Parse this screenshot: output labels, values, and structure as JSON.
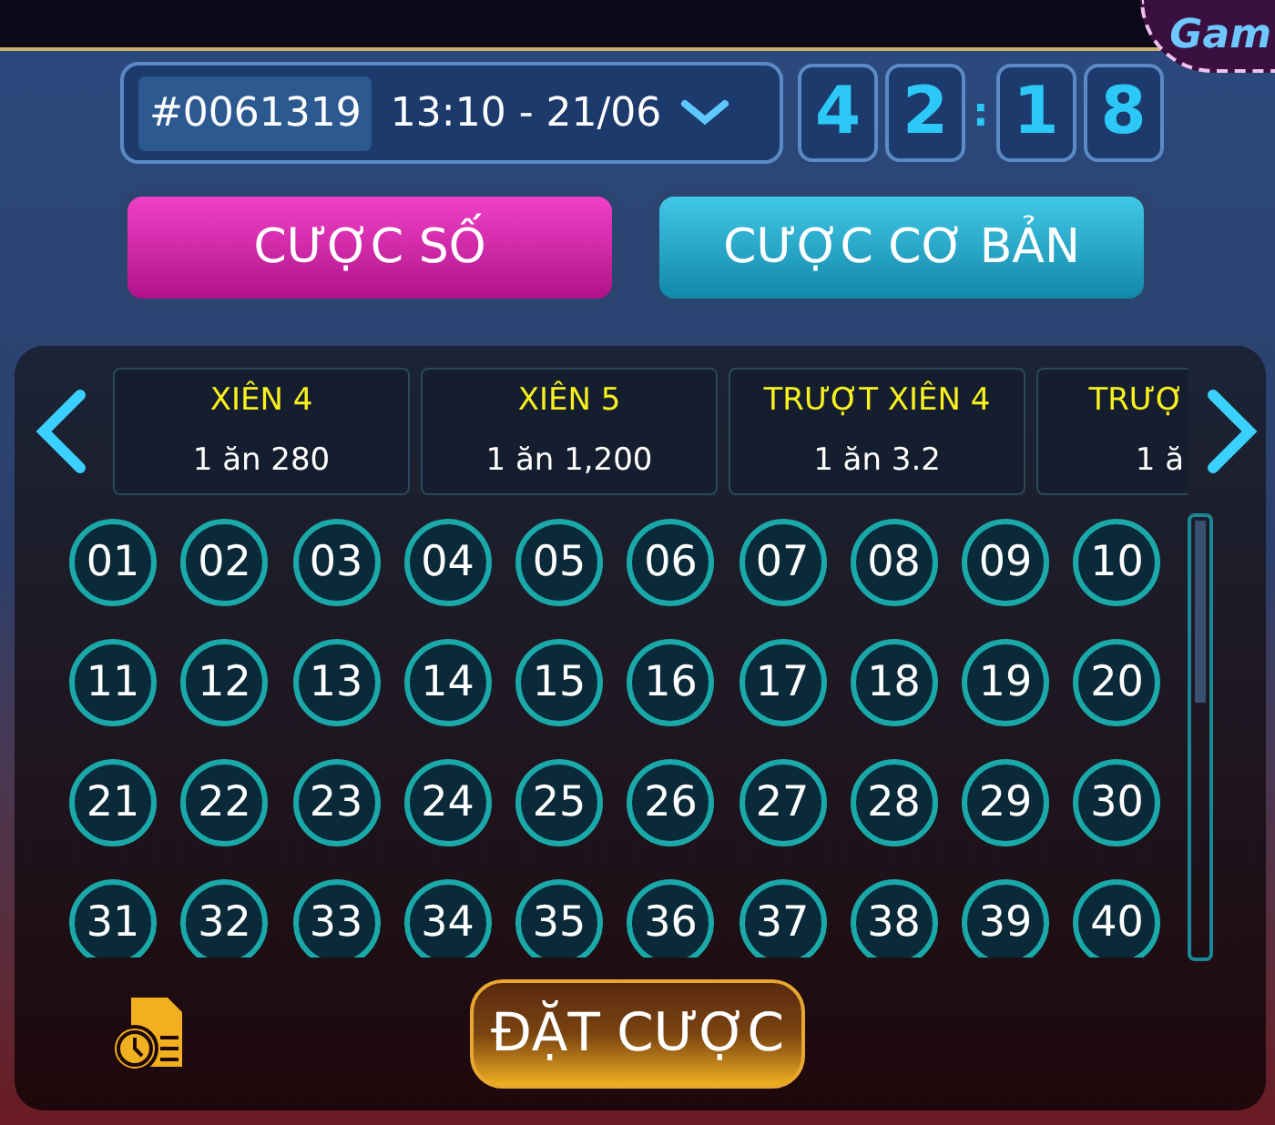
{
  "logo_text": "Gam",
  "round": {
    "id": "#0061319",
    "time": "13:10 - 21/06"
  },
  "countdown": {
    "digits": [
      "4",
      "2",
      "1",
      "8"
    ],
    "separator": ":"
  },
  "tabs": [
    {
      "label": "CƯỢC SỐ",
      "selected": true
    },
    {
      "label": "CƯỢC CƠ BẢN",
      "selected": false
    }
  ],
  "bet_types": [
    {
      "title": "XIÊN 4",
      "odds": "1 ăn 280"
    },
    {
      "title": "XIÊN 5",
      "odds": "1 ăn 1,200"
    },
    {
      "title": "TRƯỢT XIÊN 4",
      "odds": "1 ăn 3.2"
    },
    {
      "title": "TRƯỢ",
      "odds": "1 ă"
    }
  ],
  "numbers": [
    "01",
    "02",
    "03",
    "04",
    "05",
    "06",
    "07",
    "08",
    "09",
    "10",
    "11",
    "12",
    "13",
    "14",
    "15",
    "16",
    "17",
    "18",
    "19",
    "20",
    "21",
    "22",
    "23",
    "24",
    "25",
    "26",
    "27",
    "28",
    "29",
    "30",
    "31",
    "32",
    "33",
    "34",
    "35",
    "36",
    "37",
    "38",
    "39",
    "40"
  ],
  "place_bet_button": "ĐẶT CƯỢC"
}
